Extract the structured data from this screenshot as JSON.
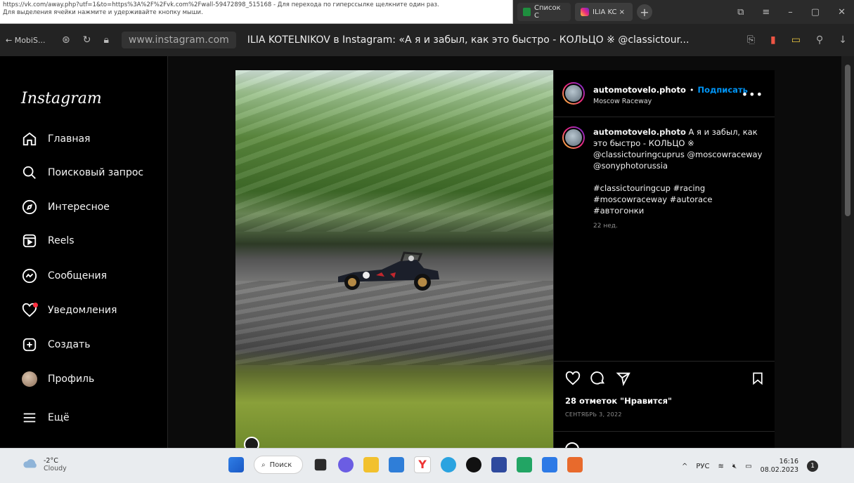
{
  "status_tooltip": {
    "line1": "https://vk.com/away.php?utf=1&to=https%3A%2F%2Fvk.com%2Fwall-59472898_515168 - Для перехода по гиперссылке щелкните один раз.",
    "line2": "Для выделения ячейки нажмите и удерживайте кнопку мыши."
  },
  "tabs": [
    {
      "label": "Список С",
      "icon": "sheets-icon"
    },
    {
      "label": "ILIA KC ×",
      "icon": "instagram-icon"
    }
  ],
  "address": {
    "back_label": "← MobiS...",
    "url": "www.instagram.com",
    "page_title": "ILIA KOTELNIKOV в Instagram: «А я и забыл, как это быстро - КОЛЬЦО ※ @classictour..."
  },
  "sidebar": {
    "logo": "Instagram",
    "items": [
      {
        "label": "Главная",
        "icon": "home-icon"
      },
      {
        "label": "Поисковый запрос",
        "icon": "search-icon"
      },
      {
        "label": "Интересное",
        "icon": "compass-icon"
      },
      {
        "label": "Reels",
        "icon": "reels-icon"
      },
      {
        "label": "Сообщения",
        "icon": "messenger-icon"
      },
      {
        "label": "Уведомления",
        "icon": "heart-icon"
      },
      {
        "label": "Создать",
        "icon": "plus-square-icon"
      },
      {
        "label": "Профиль",
        "icon": "avatar"
      },
      {
        "label": "Ещё",
        "icon": "menu-icon"
      }
    ]
  },
  "post": {
    "username": "automotovelo.photo",
    "separator": "•",
    "follow_label": "Подписать",
    "location": "Moscow Raceway",
    "caption_user": "automotovelo.photo",
    "caption_text": "А я и забыл, как это быстро - КОЛЬЦО ※ @classictouringcuprus @moscowraceway @sonyphotorussia",
    "caption_tags": "#classictouringcup #racing #moscowraceway #autorace #автогонки",
    "caption_time": "22 нед.",
    "likes": "28 отметок \"Нравится\"",
    "date": "СЕНТЯБРЬ 3, 2022"
  },
  "taskbar": {
    "weather_temp": "-2°C",
    "weather_desc": "Cloudy",
    "search_label": "Поиск",
    "lang": "РУС",
    "time": "16:16",
    "date": "08.02.2023",
    "notifications": "1"
  }
}
